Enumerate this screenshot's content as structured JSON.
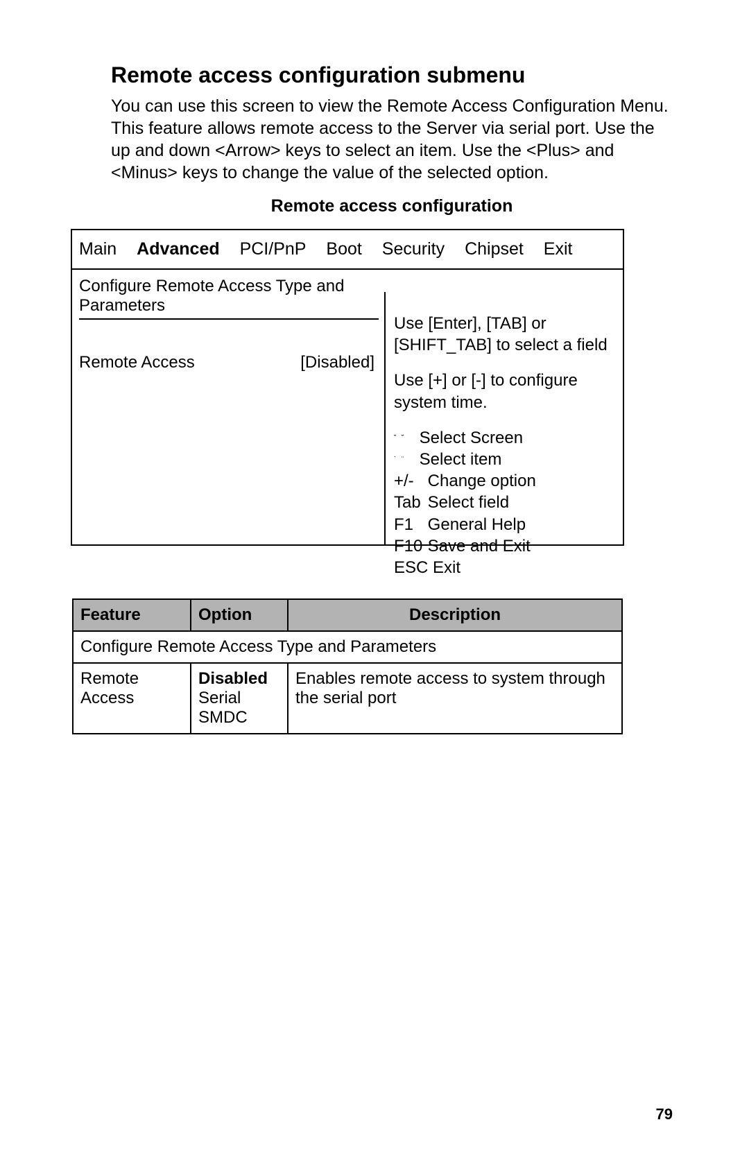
{
  "title": "Remote access configuration submenu",
  "intro": "You can use this screen to view the Remote Access Configuration Menu. This feature allows remote access to the Server via serial port. Use the up and down <Arrow> keys to select an item. Use the <Plus> and <Minus> keys to change the value of the selected option.",
  "subheading": "Remote access configuration",
  "bios": {
    "tabs": {
      "main": "Main",
      "advanced": "Advanced",
      "pcipnp": "PCI/PnP",
      "boot": "Boot",
      "security": "Security",
      "chipset": "Chipset",
      "exit": "Exit"
    },
    "leftTitle": "Configure Remote Access Type and Parameters",
    "setting": {
      "label": "Remote Access",
      "value": "[Disabled]"
    },
    "help1": "Use [Enter], [TAB] or [SHIFT_TAB] to select a field",
    "help2": "Use [+] or [-] to configure system time.",
    "legend": {
      "selectScreen": "Select Screen",
      "selectItem": "Select item",
      "change": "Change option",
      "changeKey": "+/-",
      "tab": "Select field",
      "tabKey": "Tab",
      "f1": "General Help",
      "f1Key": "F1",
      "f10": "Save and Exit",
      "f10Key": "F10",
      "esc": "ESC Exit"
    }
  },
  "table": {
    "headers": {
      "feature": "Feature",
      "option": "Option",
      "description": "Description"
    },
    "spanRow": "Configure Remote Access Type and Parameters",
    "row": {
      "feature": "Remote Access",
      "option1": "Disabled",
      "option2": "Serial",
      "option3": "SMDC",
      "description": "Enables remote access to system through the serial port"
    }
  },
  "pageNumber": "79"
}
